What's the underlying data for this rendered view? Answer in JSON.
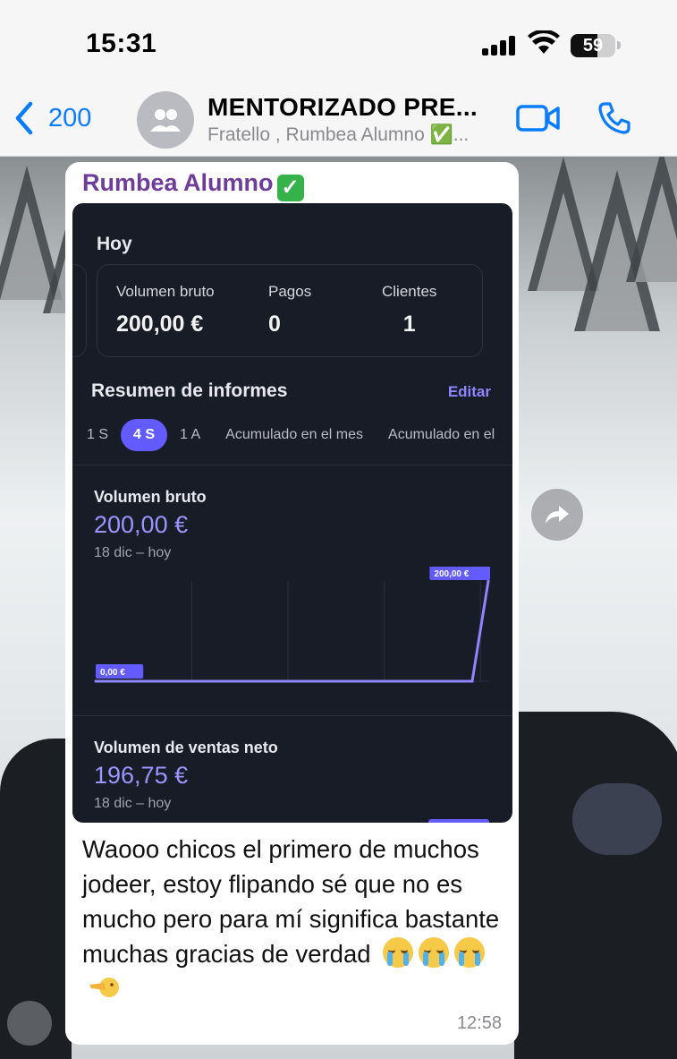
{
  "status_bar": {
    "time": "15:31",
    "battery": "59",
    "battery_level": 0.59
  },
  "header": {
    "back_label": "200",
    "title": "MENTORIZADO PRE...",
    "subtitle": "Fratello , Rumbea Alumno ✅..."
  },
  "message": {
    "sender": "Rumbea Alumno",
    "text": "Waooo chicos el primero de muchos jodeer, estoy flipando sé que no es mucho pero para mí significa bastante muchas gracias de verdad",
    "time": "12:58",
    "icons": [
      "crying-face-icon",
      "crying-face-icon",
      "crying-face-icon",
      "pointing-hand-icon"
    ]
  },
  "dashboard": {
    "today_label": "Hoy",
    "stats": [
      {
        "label": "Volumen bruto",
        "value": "200,00 €"
      },
      {
        "label": "Pagos",
        "value": "0"
      },
      {
        "label": "Clientes",
        "value": "1"
      }
    ],
    "report_title": "Resumen de informes",
    "edit_label": "Editar",
    "tabs": [
      "1 S",
      "4 S",
      "1 A",
      "Acumulado en el mes",
      "Acumulado en el"
    ],
    "active_tab": "4 S",
    "gross": {
      "title": "Volumen bruto",
      "value": "200,00 €",
      "range": "18 dic – hoy"
    },
    "net": {
      "title": "Volumen de ventas neto",
      "value": "196,75 €",
      "range": "18 dic – hoy"
    }
  },
  "chart_data": {
    "type": "line",
    "x": [
      "18 dic",
      "",
      "",
      "",
      "hoy"
    ],
    "values": [
      0,
      0,
      0,
      0,
      200
    ],
    "ylim": [
      0,
      200
    ],
    "start_label": "0,00 €",
    "end_label": "200,00 €",
    "grid": "vertical",
    "color": "#8f86ff"
  }
}
